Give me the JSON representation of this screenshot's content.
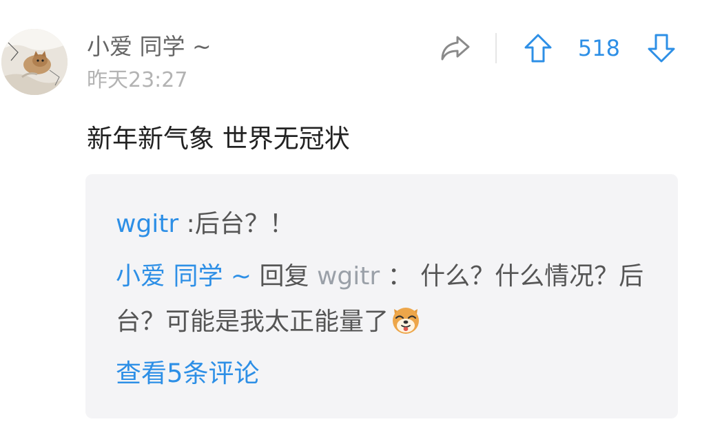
{
  "post": {
    "author": "小爱 同学 ~",
    "timestamp": "昨天23:27",
    "content": "新年新气象 世界无冠状",
    "avatar_icon": "cat-photo-avatar",
    "share_icon": "share-arrow-icon",
    "upvote_icon": "upvote-arrow-icon",
    "downvote_icon": "downvote-arrow-icon",
    "vote_count": "518"
  },
  "replies": {
    "first": {
      "author": "wgitr",
      "separator": ":",
      "text": "后台？！"
    },
    "second": {
      "author": "小爱 同学 ~",
      "reply_word": "回复",
      "reply_to": "wgitr",
      "separator": "：",
      "text": "什么？什么情况？后台？可能是我太正能量了",
      "emoji_icon": "shiba-dog-emoji"
    },
    "view_more": "查看5条评论"
  },
  "colors": {
    "accent": "#2d8fe6",
    "reply_background": "#f4f4f6",
    "username": "#666666",
    "timestamp": "#b3b3b3"
  }
}
